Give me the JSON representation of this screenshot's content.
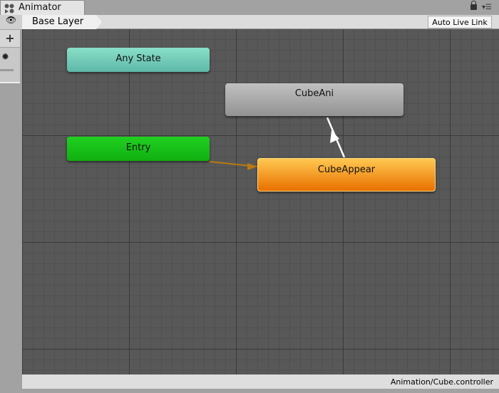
{
  "window": {
    "tab_title": "Animator",
    "icon": "animator-icon"
  },
  "toolbar": {
    "breadcrumb": "Base Layer",
    "auto_live_link": "Auto Live Link"
  },
  "states": {
    "any_state": "Any State",
    "entry": "Entry",
    "cube_ani": "CubeAni",
    "cube_appear": "CubeAppear"
  },
  "status": {
    "path": "Animation/Cube.controller"
  },
  "colors": {
    "any_state": "#6fcab6",
    "entry": "#14c014",
    "default_state": "#f28a14",
    "state": "#a8a8a8"
  }
}
